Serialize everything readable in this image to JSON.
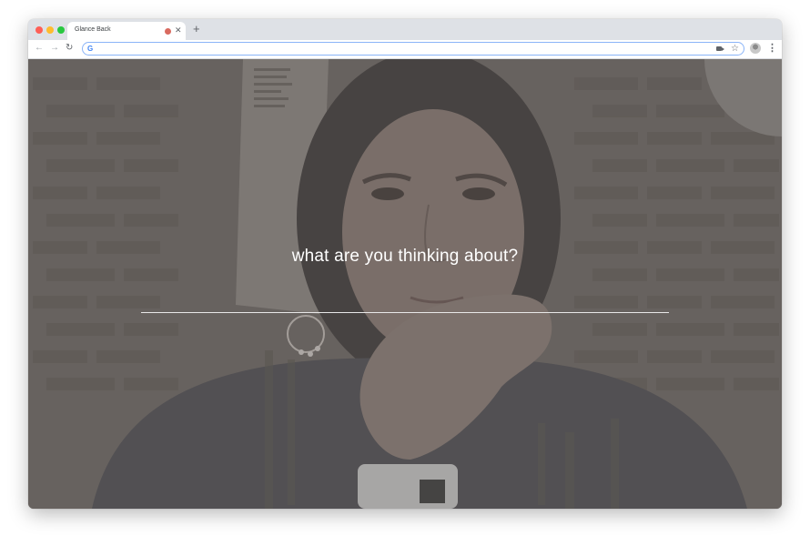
{
  "browser": {
    "tab": {
      "title": "Glance Back",
      "recording_indicator_color": "#d96a5f",
      "close_icon": "close-icon"
    },
    "new_tab_icon": "plus-icon",
    "toolbar": {
      "back_icon": "back-arrow-icon",
      "forward_icon": "forward-arrow-icon",
      "reload_icon": "reload-icon",
      "omnibox_value": "",
      "camera_icon": "video-camera-icon",
      "bookmark_icon": "star-icon",
      "profile_icon": "avatar",
      "menu_icon": "kebab-menu-icon"
    }
  },
  "page": {
    "prompt": "what are you thinking about?",
    "entry_value": "",
    "background": "webcam-video-feed"
  },
  "colors": {
    "tabstrip": "#dee1e6",
    "omnibox_focus": "#8ab4f8",
    "prompt_text": "#ffffff",
    "overlay": "#5c5856"
  }
}
